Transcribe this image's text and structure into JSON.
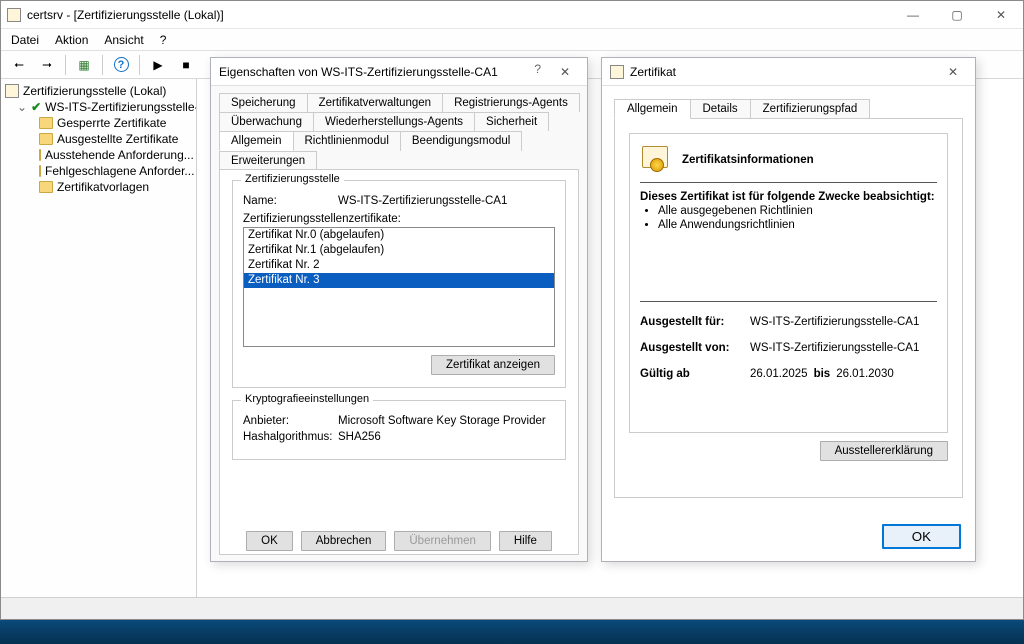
{
  "app": {
    "title": "certsrv - [Zertifizierungsstelle (Lokal)]",
    "menu": [
      "Datei",
      "Aktion",
      "Ansicht",
      "?"
    ]
  },
  "tree": {
    "root": "Zertifizierungsstelle (Lokal)",
    "ca": "WS-ITS-Zertifizierungsstelle-C...",
    "items": [
      "Gesperrte Zertifikate",
      "Ausgestellte Zertifikate",
      "Ausstehende Anforderung...",
      "Fehlgeschlagene Anforder...",
      "Zertifikatvorlagen"
    ]
  },
  "props": {
    "title": "Eigenschaften von WS-ITS-Zertifizierungsstelle-CA1",
    "tabs_row1": [
      "Speicherung",
      "Zertifikatverwaltungen",
      "Registrierungs-Agents"
    ],
    "tabs_row2": [
      "Überwachung",
      "Wiederherstellungs-Agents",
      "Sicherheit"
    ],
    "tabs_row3": [
      "Allgemein",
      "Richtlinienmodul",
      "Beendigungsmodul",
      "Erweiterungen"
    ],
    "group1": "Zertifizierungsstelle",
    "name_lbl": "Name:",
    "name_val": "WS-ITS-Zertifizierungsstelle-CA1",
    "listlabel": "Zertifizierungsstellenzertifikate:",
    "certs": [
      "Zertifikat Nr.0 (abgelaufen)",
      "Zertifikat Nr.1 (abgelaufen)",
      "Zertifikat Nr. 2",
      "Zertifikat Nr. 3"
    ],
    "view_btn": "Zertifikat anzeigen",
    "group2": "Kryptografieeinstellungen",
    "provider_lbl": "Anbieter:",
    "provider_val": "Microsoft Software Key Storage Provider",
    "hash_lbl": "Hashalgorithmus:",
    "hash_val": "SHA256",
    "ok": "OK",
    "cancel": "Abbrechen",
    "apply": "Übernehmen",
    "help": "Hilfe"
  },
  "cert": {
    "title": "Zertifikat",
    "tabs": [
      "Allgemein",
      "Details",
      "Zertifizierungspfad"
    ],
    "info_header": "Zertifikatsinformationen",
    "purpose_intro": "Dieses Zertifikat ist für folgende Zwecke beabsichtigt:",
    "purposes": [
      "Alle ausgegebenen Richtlinien",
      "Alle Anwendungsrichtlinien"
    ],
    "issued_to_lbl": "Ausgestellt für:",
    "issued_to_val": "WS-ITS-Zertifizierungsstelle-CA1",
    "issued_by_lbl": "Ausgestellt von:",
    "issued_by_val": "WS-ITS-Zertifizierungsstelle-CA1",
    "valid_from_lbl": "Gültig ab",
    "valid_from_val": "26.01.2025",
    "valid_to_lbl": "bis",
    "valid_to_val": "26.01.2030",
    "issuer_btn": "Ausstellererklärung",
    "ok": "OK"
  }
}
